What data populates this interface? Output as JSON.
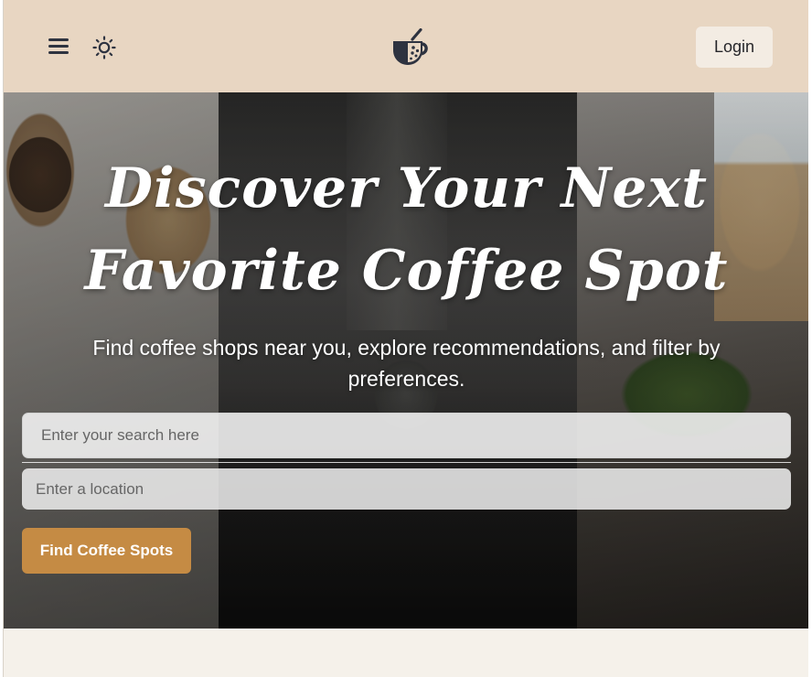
{
  "navbar": {
    "menu_icon": "hamburger-menu-icon",
    "theme_icon": "sun-icon",
    "logo_icon": "coffee-cup-logo-icon",
    "login_label": "Login"
  },
  "hero": {
    "title_line1": "Discover Your Next",
    "title_line2": "Favorite Coffee Spot",
    "subtitle": "Find coffee shops near you, explore recommendations, and filter by preferences.",
    "search": {
      "placeholder": "Enter your search here",
      "value": ""
    },
    "location": {
      "placeholder": "Enter a location",
      "value": ""
    },
    "cta_label": "Find Coffee Spots"
  },
  "colors": {
    "navbar_bg": "#e8d6c2",
    "accent": "#c58b44",
    "page_bg": "#f5f1ea",
    "icon": "#2e3340"
  }
}
